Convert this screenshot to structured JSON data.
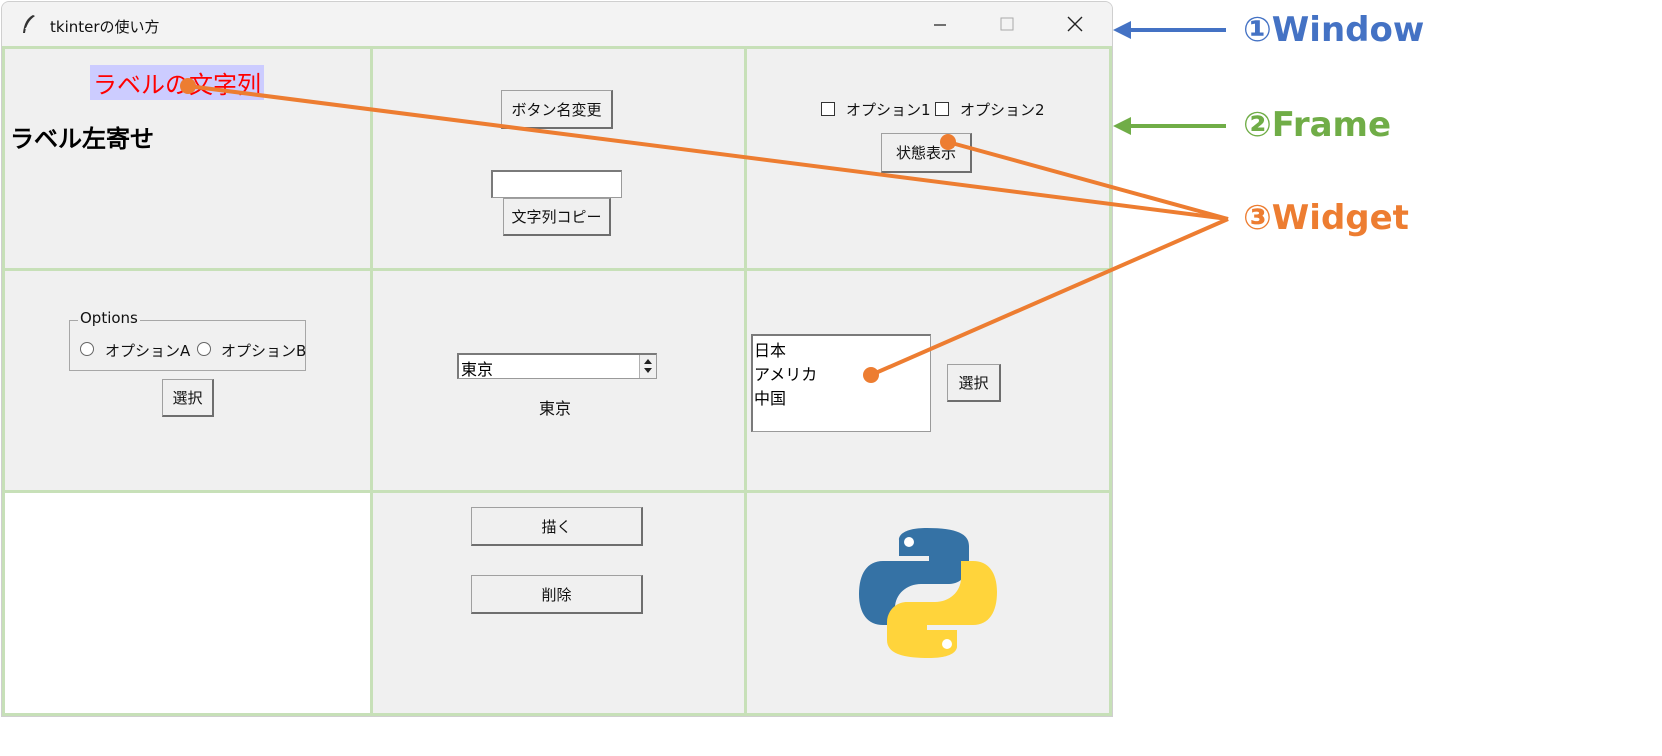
{
  "window": {
    "title": "tkinterの使い方",
    "controls": {
      "minimize": "minimize-icon",
      "maximize": "maximize-icon",
      "close": "close-icon"
    }
  },
  "frame1": {
    "colored_label": "ラベルの文字列",
    "left_label": "ラベル左寄せ"
  },
  "frame2": {
    "rename_button": "ボタン名変更",
    "entry_value": "",
    "copy_button": "文字列コピー"
  },
  "frame3": {
    "checkbox1": {
      "label": "オプション1",
      "checked": false
    },
    "checkbox2": {
      "label": "オプション2",
      "checked": false
    },
    "status_button": "状態表示"
  },
  "frame4": {
    "group_title": "Options",
    "radio_a": {
      "label": "オプションA",
      "selected": false
    },
    "radio_b": {
      "label": "オプションB",
      "selected": false
    },
    "select_button": "選択"
  },
  "frame5": {
    "spinbox_value": "東京",
    "result_label": "東京"
  },
  "frame6": {
    "listbox_items": [
      "日本",
      "アメリカ",
      "中国"
    ],
    "select_button": "選択"
  },
  "frame8": {
    "draw_button": "描く",
    "delete_button": "削除"
  },
  "frame9": {
    "logo": "python-logo"
  },
  "annotations": [
    {
      "label": "①Window",
      "color": "#4472c4"
    },
    {
      "label": "②Frame",
      "color": "#70ad47"
    },
    {
      "label": "③Widget",
      "color": "#ed7d31"
    }
  ]
}
